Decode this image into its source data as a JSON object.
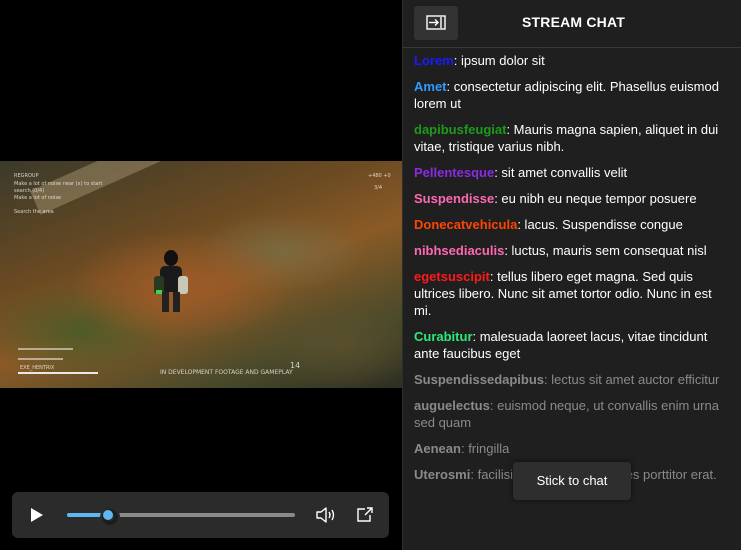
{
  "video": {
    "hud_top_left": [
      "REGROUP",
      "Make a lot of noise near (x) to start",
      "search (0/4)",
      "Make a lot of noise",
      "Search the area"
    ],
    "hud_top_right": [
      "+480 +0",
      "3/4"
    ],
    "hud_bottom_left": [
      "EXE_HENTRIX"
    ],
    "watermark": "IN DEVELOPMENT FOOTAGE AND GAMEPLAY",
    "hud_ammo": "14"
  },
  "player": {
    "progress": 0.18,
    "accent_color": "#60b7f0",
    "icons": {
      "play": "play-icon",
      "volume": "volume-icon",
      "popout": "popout-icon"
    }
  },
  "chat": {
    "title": "STREAM CHAT",
    "collapse_icon": "collapse-panel-icon",
    "stick_label": "Stick to chat",
    "messages": [
      {
        "user": "Lorem",
        "color": "#1a1aff",
        "text": ": ipsum dolor sit",
        "faded": false
      },
      {
        "user": "Amet",
        "color": "#2d9cff",
        "text": ": consectetur adipiscing elit. Phasellus euismod lorem ut",
        "faded": false
      },
      {
        "user": "dapibusfeugiat",
        "color": "#1c9a1c",
        "text": ": Mauris magna sapien, aliquet in dui vitae, tristique varius nibh.",
        "faded": false
      },
      {
        "user": "Pellentesque",
        "color": "#8a2be2",
        "text": ": sit amet convallis velit",
        "faded": false
      },
      {
        "user": "Suspendisse",
        "color": "#ff69b4",
        "text": ": eu nibh eu neque tempor posuere",
        "faded": false
      },
      {
        "user": "Donecatvehicula",
        "color": "#ff4500",
        "text": ": lacus. Suspendisse congue",
        "faded": false
      },
      {
        "user": "nibhsediaculis",
        "color": "#ff69b4",
        "text": ": luctus, mauris sem consequat nisl",
        "faded": false
      },
      {
        "user": "egetsuscipit",
        "color": "#ff1a1a",
        "text": ": tellus libero eget magna. Sed quis ultrices libero. Nunc sit amet tortor odio. Nunc in est mi.",
        "faded": false
      },
      {
        "user": "Curabitur",
        "color": "#2ee87a",
        "text": ": malesuada laoreet lacus, vitae tincidunt ante faucibus eget",
        "faded": false
      },
      {
        "user": "Suspendissedapibus",
        "color": "#8a8a8a",
        "text": ": lectus sit amet auctor efficitur",
        "faded": true
      },
      {
        "user": "auguelectus",
        "color": "#8a8a8a",
        "text": ": euismod neque, ut convallis enim urna sed quam",
        "faded": true
      },
      {
        "user": "Aenean",
        "color": "#8a8a8a",
        "text": ": fringilla",
        "faded": true
      },
      {
        "user": "Uterosmi",
        "color": "#8a8a8a",
        "text": ": facilisis nec eros at, sodales porttitor erat.",
        "faded": true
      }
    ]
  }
}
